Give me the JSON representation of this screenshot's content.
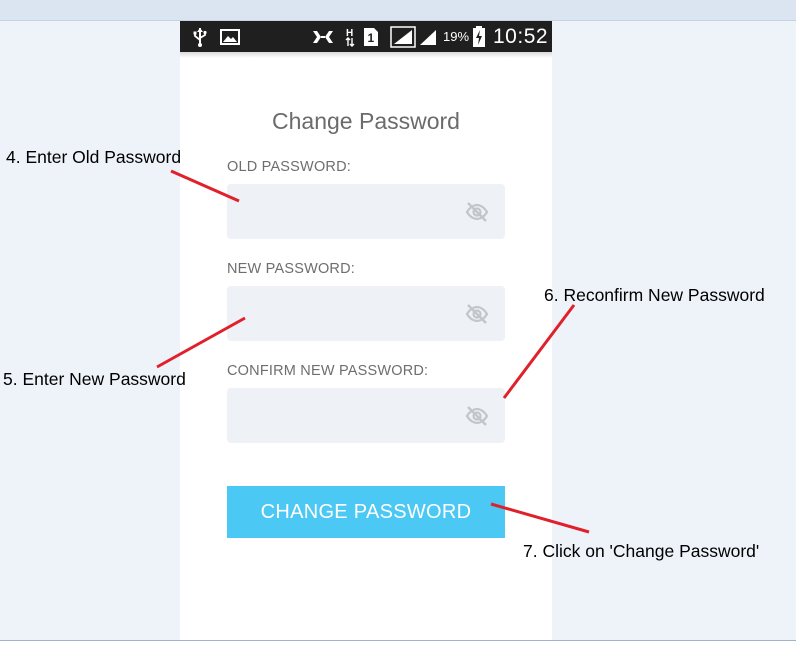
{
  "status_bar": {
    "battery_percent": "19%",
    "time": "10:52",
    "icons": [
      "usb-icon",
      "image-icon",
      "nfc-icon",
      "h-plus-data-icon",
      "sim-1-icon",
      "signal-icon",
      "signal-icon",
      "battery-charging-icon"
    ]
  },
  "screen": {
    "title": "Change Password",
    "old_password": {
      "label": "OLD PASSWORD:",
      "value": ""
    },
    "new_password": {
      "label": "NEW PASSWORD:",
      "value": ""
    },
    "confirm_password": {
      "label": "CONFIRM NEW PASSWORD:",
      "value": ""
    },
    "submit_label": "CHANGE PASSWORD",
    "visibility_icon": "eye-off-icon"
  },
  "annotations": {
    "step4": "4. Enter Old Password",
    "step5": "5. Enter New Password",
    "step6": "6. Reconfirm New Password",
    "step7": "7. Click on 'Change Password'"
  },
  "colors": {
    "page_background": "#eef3fa",
    "status_bar": "#1f1f1f",
    "input_background": "#eef1f5",
    "button": "#4bc8f3",
    "annotation_line": "#e0202a"
  }
}
